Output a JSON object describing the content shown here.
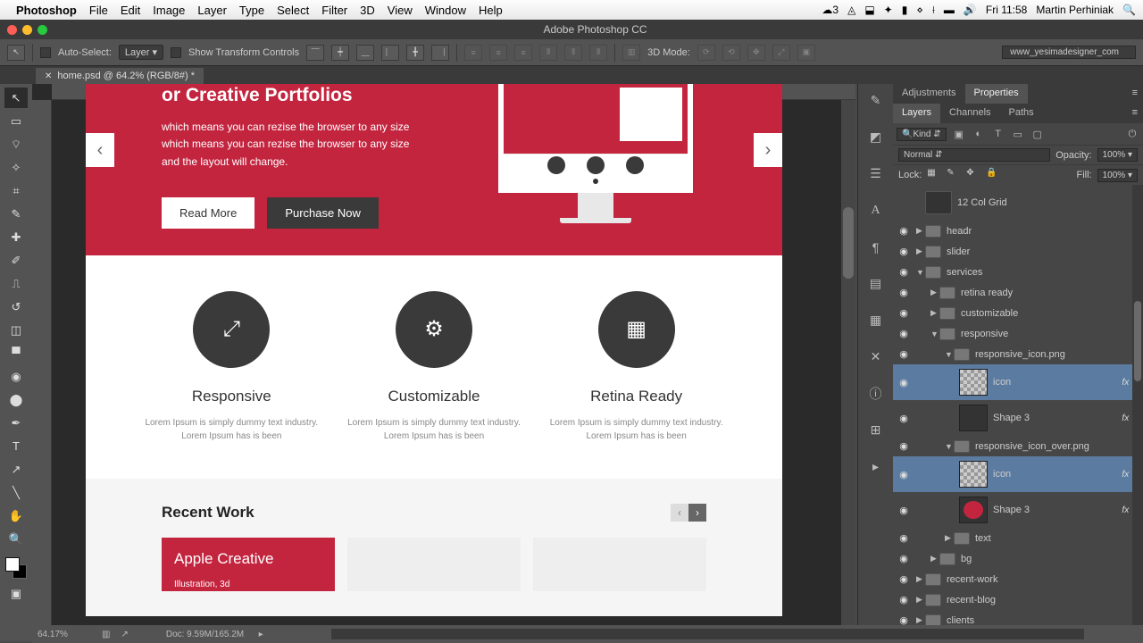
{
  "menubar": {
    "app": "Photoshop",
    "items": [
      "File",
      "Edit",
      "Image",
      "Layer",
      "Type",
      "Select",
      "Filter",
      "3D",
      "View",
      "Window",
      "Help"
    ],
    "cloud_count": "3",
    "clock": "Fri 11:58",
    "user": "Martin Perhiniak"
  },
  "window_title": "Adobe Photoshop CC",
  "options": {
    "auto_select": "Auto-Select:",
    "auto_select_target": "Layer",
    "show_transform": "Show Transform Controls",
    "mode_3d": "3D Mode:",
    "workspace": "www_yesimadesigner_com"
  },
  "tab": {
    "label": "home.psd @ 64.2% (RGB/8#) *"
  },
  "design": {
    "hero_title": "or Creative Portfolios",
    "hero_body": "which means you can rezise the browser to any size which means you can rezise the browser to any size and the layout will change.",
    "btn_read": "Read More",
    "btn_buy": "Purchase Now",
    "svc": [
      {
        "title": "Responsive",
        "body": "Lorem Ipsum is simply dummy text industry. Lorem Ipsum has is been"
      },
      {
        "title": "Customizable",
        "body": "Lorem Ipsum is simply dummy text industry. Lorem Ipsum has is been"
      },
      {
        "title": "Retina Ready",
        "body": "Lorem Ipsum is simply dummy text industry. Lorem Ipsum has is been"
      }
    ],
    "recent_title": "Recent Work",
    "card1_title": "Apple Creative",
    "card1_sub": "Illustration, 3d"
  },
  "panels": {
    "group1": [
      "Adjustments",
      "Properties"
    ],
    "group2": [
      "Layers",
      "Channels",
      "Paths"
    ],
    "kind": "Kind",
    "blend": "Normal",
    "opacity_label": "Opacity:",
    "opacity": "100%",
    "lock_label": "Lock:",
    "fill_label": "Fill:",
    "fill": "100%"
  },
  "layers": [
    {
      "indent": 0,
      "type": "grid",
      "name": "12 Col Grid",
      "vis": false,
      "tall": true
    },
    {
      "indent": 0,
      "type": "folder",
      "name": "headr",
      "open": false
    },
    {
      "indent": 0,
      "type": "folder",
      "name": "slider",
      "open": false
    },
    {
      "indent": 0,
      "type": "folder",
      "name": "services",
      "open": true
    },
    {
      "indent": 1,
      "type": "folder",
      "name": "retina ready",
      "open": false
    },
    {
      "indent": 1,
      "type": "folder",
      "name": "customizable",
      "open": false
    },
    {
      "indent": 1,
      "type": "folder",
      "name": "responsive",
      "open": true
    },
    {
      "indent": 2,
      "type": "folder",
      "name": "responsive_icon.png",
      "open": true
    },
    {
      "indent": 3,
      "type": "layer",
      "name": "icon",
      "sel": true,
      "fx": true,
      "tall": true,
      "chk": true
    },
    {
      "indent": 3,
      "type": "layer",
      "name": "Shape 3",
      "fx": true,
      "tall": true
    },
    {
      "indent": 2,
      "type": "folder",
      "name": "responsive_icon_over.png",
      "open": true
    },
    {
      "indent": 3,
      "type": "layer",
      "name": "icon",
      "sel": true,
      "fx": true,
      "tall": true,
      "chk": true
    },
    {
      "indent": 3,
      "type": "layer",
      "name": "Shape 3",
      "fx": true,
      "tall": true,
      "red": true
    },
    {
      "indent": 2,
      "type": "folder",
      "name": "text",
      "open": false
    },
    {
      "indent": 1,
      "type": "folder",
      "name": "bg",
      "open": false
    },
    {
      "indent": 0,
      "type": "folder",
      "name": "recent-work",
      "open": false
    },
    {
      "indent": 0,
      "type": "folder",
      "name": "recent-blog",
      "open": false
    },
    {
      "indent": 0,
      "type": "folder",
      "name": "clients",
      "open": false
    }
  ],
  "status": {
    "zoom": "64.17%",
    "doc": "Doc: 9.59M/165.2M"
  }
}
